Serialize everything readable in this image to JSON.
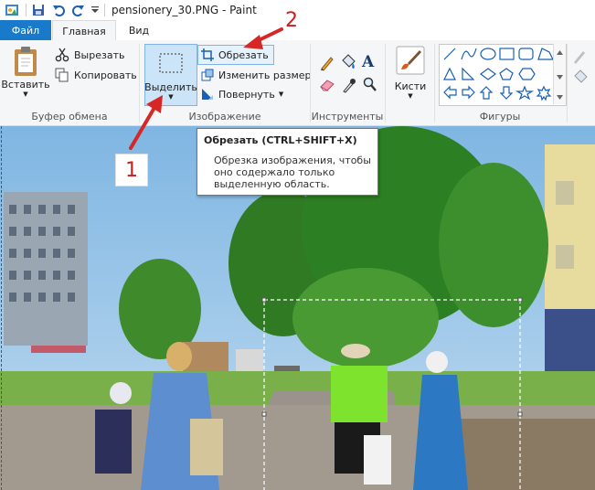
{
  "window": {
    "title": "pensionery_30.PNG - Paint"
  },
  "tabs": {
    "file": "Файл",
    "home": "Главная",
    "view": "Вид"
  },
  "clipboard": {
    "paste": "Вставить",
    "cut": "Вырезать",
    "copy": "Копировать",
    "group": "Буфер обмена"
  },
  "image": {
    "select": "Выделить",
    "crop": "Обрезать",
    "resize": "Изменить размер",
    "rotate": "Повернуть",
    "group": "Изображение"
  },
  "tools": {
    "group": "Инструменты"
  },
  "brushes": {
    "label": "Кисти"
  },
  "shapes": {
    "group": "Фигуры"
  },
  "tooltip": {
    "title": "Обрезать (CTRL+SHIFT+X)",
    "text": "Обрезка изображения, чтобы оно содержало только выделенную область."
  },
  "annotations": {
    "one": "1",
    "two": "2"
  },
  "colors": {
    "file_tab": "#1979ca",
    "annotation": "#c81e1e",
    "selected": "#cce4f7"
  }
}
